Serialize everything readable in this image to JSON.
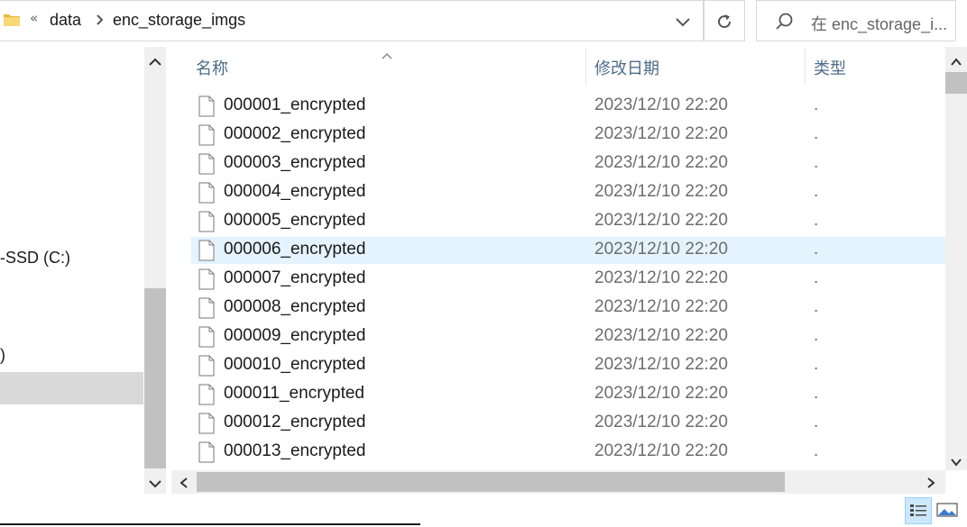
{
  "address": {
    "collapse_chevron": "«",
    "crumbs": [
      "data",
      "enc_storage_imgs"
    ]
  },
  "search": {
    "placeholder": "在 enc_storage_i..."
  },
  "nav": {
    "items": [
      {
        "label": "-SSD (C:)"
      },
      {
        "label": ")"
      }
    ]
  },
  "columns": {
    "name": "名称",
    "date": "修改日期",
    "type": "类型"
  },
  "files": [
    {
      "name": "000001_encrypted",
      "date": "2023/12/10 22:20",
      "type": "."
    },
    {
      "name": "000002_encrypted",
      "date": "2023/12/10 22:20",
      "type": "."
    },
    {
      "name": "000003_encrypted",
      "date": "2023/12/10 22:20",
      "type": "."
    },
    {
      "name": "000004_encrypted",
      "date": "2023/12/10 22:20",
      "type": "."
    },
    {
      "name": "000005_encrypted",
      "date": "2023/12/10 22:20",
      "type": "."
    },
    {
      "name": "000006_encrypted",
      "date": "2023/12/10 22:20",
      "type": "."
    },
    {
      "name": "000007_encrypted",
      "date": "2023/12/10 22:20",
      "type": "."
    },
    {
      "name": "000008_encrypted",
      "date": "2023/12/10 22:20",
      "type": "."
    },
    {
      "name": "000009_encrypted",
      "date": "2023/12/10 22:20",
      "type": "."
    },
    {
      "name": "000010_encrypted",
      "date": "2023/12/10 22:20",
      "type": "."
    },
    {
      "name": "000011_encrypted",
      "date": "2023/12/10 22:20",
      "type": "."
    },
    {
      "name": "000012_encrypted",
      "date": "2023/12/10 22:20",
      "type": "."
    },
    {
      "name": "000013_encrypted",
      "date": "2023/12/10 22:20",
      "type": "."
    }
  ],
  "hover_row_index": 5,
  "icons": {
    "folder": "folder-icon",
    "refresh": "refresh-icon",
    "search": "search-icon",
    "file": "file-icon",
    "details_view": "details-view-icon",
    "large_icons_view": "large-icons-view-icon"
  },
  "colors": {
    "hover_row": "#e5f3ff",
    "selected_nav": "#d9d9d9",
    "column_header": "#4d6d8a",
    "folder": "#f8d775"
  }
}
